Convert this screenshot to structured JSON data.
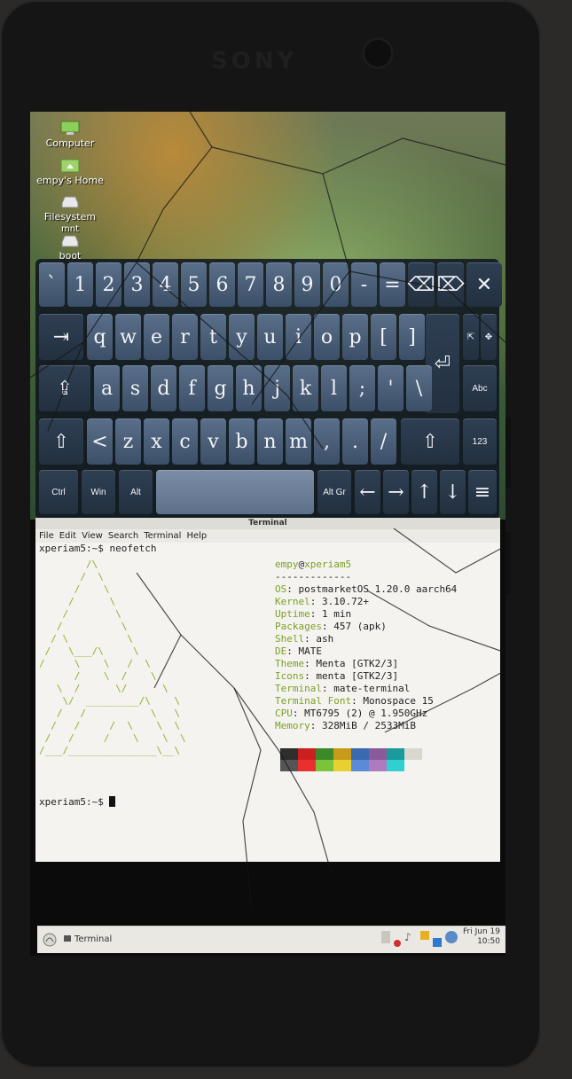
{
  "device": {
    "brand": "SONY"
  },
  "desktop_icons": [
    {
      "label": "Computer",
      "icon": "computer-icon"
    },
    {
      "label": "empy's Home",
      "icon": "home-folder-icon"
    },
    {
      "label": "Filesystem",
      "icon": "drive-icon"
    },
    {
      "label": "boot",
      "icon": "drive-icon"
    }
  ],
  "desktop_icon_partial": "mnt",
  "keyboard": {
    "row1": [
      "`",
      "1",
      "2",
      "3",
      "4",
      "5",
      "6",
      "7",
      "8",
      "9",
      "0",
      "-",
      "="
    ],
    "row1_specials": [
      "⌫",
      "⌦",
      "✕"
    ],
    "row2_tab": "⇥",
    "row2": [
      "q",
      "w",
      "e",
      "r",
      "t",
      "y",
      "u",
      "i",
      "o",
      "p",
      "[",
      "]"
    ],
    "row2_specials": [
      "⇱",
      "✥"
    ],
    "enter": "⏎",
    "row3_caps": "⇪",
    "row3": [
      "a",
      "s",
      "d",
      "f",
      "g",
      "h",
      "j",
      "k",
      "l",
      ";",
      "'",
      "\\"
    ],
    "row3_special": "Abc",
    "row4_shift": "⇧",
    "row4": [
      "<",
      "z",
      "x",
      "c",
      "v",
      "b",
      "n",
      "m",
      ",",
      ".",
      "/"
    ],
    "row4_shift_right": "⇧",
    "row4_special": "123",
    "row5_mods": [
      "Ctrl",
      "Win",
      "Alt"
    ],
    "row5_altgr": "Alt Gr",
    "arrows": [
      "←",
      "→",
      "↑",
      "↓"
    ],
    "menu": "≡"
  },
  "terminal": {
    "title": "Terminal",
    "menu": [
      "File",
      "Edit",
      "View",
      "Search",
      "Terminal",
      "Help"
    ],
    "command_line": "xperiam5:~$ neofetch",
    "prompt_line": "xperiam5:~$ ",
    "ascii_art": "        /\\\n       /  \\\n      /    \\\n     /      \\\n    /        \\\n   /          \\\n  / \\          \\\n /   \\___/\\     \\\n/     \\    \\   /  \\\n      /    \\  /    \\\n   \\  /      \\/      \\\n    \\/  _________/\\    \\\n   /   /           \\   \\\n  /   /     /  \\    \\  \\\n /   /     /    \\    \\  \\\n/___/_______________\\__\\",
    "neofetch": {
      "header_user": "empy",
      "header_at": "@",
      "header_host": "xperiam5",
      "separator": "-------------",
      "fields": [
        {
          "key": "OS",
          "value": "postmarketOS 1.20.0 aarch64"
        },
        {
          "key": "Kernel",
          "value": "3.10.72+"
        },
        {
          "key": "Uptime",
          "value": "1 min"
        },
        {
          "key": "Packages",
          "value": "457 (apk)"
        },
        {
          "key": "Shell",
          "value": "ash"
        },
        {
          "key": "DE",
          "value": "MATE"
        },
        {
          "key": "Theme",
          "value": "Menta [GTK2/3]"
        },
        {
          "key": "Icons",
          "value": "menta [GTK2/3]"
        },
        {
          "key": "Terminal",
          "value": "mate-terminal"
        },
        {
          "key": "Terminal Font",
          "value": "Monospace 15"
        },
        {
          "key": "CPU",
          "value": "MT6795 (2) @ 1.950GHz"
        },
        {
          "key": "Memory",
          "value": "328MiB / 2533MiB"
        }
      ],
      "colors_row1": [
        "#2e2e2e",
        "#cc2020",
        "#3a8a2a",
        "#c89a1a",
        "#3a6ab0",
        "#8a5a9a",
        "#1a9a9a",
        "#d8d8d0"
      ],
      "colors_row2": [
        "#555555",
        "#e83030",
        "#7ac43a",
        "#e8d030",
        "#5a8ad8",
        "#b07ac0",
        "#30d0d0"
      ]
    }
  },
  "panel": {
    "task": "Terminal",
    "date": "Fri Jun 19",
    "time": "10:50"
  }
}
